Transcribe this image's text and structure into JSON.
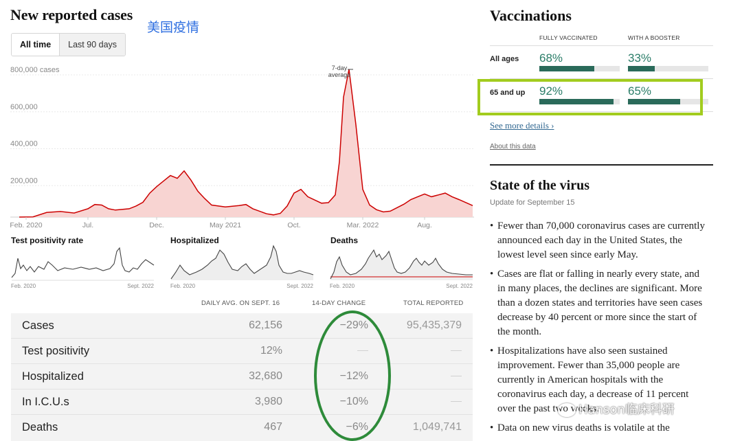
{
  "cases_panel": {
    "title": "New reported cases",
    "annotation": "美国疫情",
    "toggle": {
      "active": "All time",
      "inactive": "Last 90 days"
    }
  },
  "chart_data": {
    "type": "area",
    "title": "",
    "ylabel": "cases",
    "y_ticks": [
      "800,000 cases",
      "600,000",
      "400,000",
      "200,000"
    ],
    "ylim": [
      0,
      850000
    ],
    "x_ticks": [
      "Feb. 2020",
      "Jul.",
      "Dec.",
      "May 2021",
      "Oct.",
      "Mar. 2022",
      "Aug."
    ],
    "peak_annotation": [
      "7-day",
      "average"
    ],
    "series": [
      {
        "name": "",
        "x_month_index": [
          0,
          1,
          2,
          3,
          4,
          5,
          5.5,
          6,
          6.5,
          7,
          8,
          8.5,
          9,
          9.5,
          10,
          10.5,
          11,
          11.5,
          12,
          12.5,
          13,
          13.5,
          14,
          15,
          16,
          16.5,
          17,
          18,
          18.5,
          19,
          19.5,
          20,
          20.5,
          21,
          22,
          22.5,
          23,
          23.3,
          23.6,
          24,
          24.5,
          25,
          25.5,
          26,
          26.5,
          27,
          28,
          28.5,
          29,
          29.5,
          30,
          30.5,
          31,
          31.5,
          32,
          33
        ],
        "values": [
          0,
          1000,
          25000,
          30000,
          22000,
          45000,
          68000,
          65000,
          45000,
          38000,
          45000,
          60000,
          80000,
          130000,
          165000,
          195000,
          225000,
          210000,
          250000,
          200000,
          140000,
          100000,
          65000,
          55000,
          62000,
          68000,
          45000,
          18000,
          12000,
          20000,
          60000,
          130000,
          150000,
          110000,
          75000,
          78000,
          120000,
          300000,
          650000,
          800000,
          500000,
          150000,
          65000,
          40000,
          28000,
          32000,
          70000,
          95000,
          110000,
          125000,
          110000,
          120000,
          130000,
          110000,
          95000,
          62000
        ]
      }
    ]
  },
  "mini_charts": [
    {
      "title": "Test positivity rate",
      "start": "Feb. 2020",
      "end": "Sept. 2022"
    },
    {
      "title": "Hospitalized",
      "start": "Feb. 2020",
      "end": "Sept. 2022"
    },
    {
      "title": "Deaths",
      "start": "Feb. 2020",
      "end": "Sept. 2022"
    }
  ],
  "table": {
    "headers": [
      "DAILY AVG. ON SEPT. 16",
      "14-DAY CHANGE",
      "TOTAL REPORTED"
    ],
    "rows": [
      {
        "label": "Cases",
        "daily": "62,156",
        "change": "−29%",
        "total": "95,435,379"
      },
      {
        "label": "Test positivity",
        "daily": "12%",
        "change": "",
        "total": ""
      },
      {
        "label": "Hospitalized",
        "daily": "32,680",
        "change": "−12%",
        "total": ""
      },
      {
        "label": "In I.C.U.s",
        "daily": "3,980",
        "change": "−10%",
        "total": ""
      },
      {
        "label": "Deaths",
        "daily": "467",
        "change": "−6%",
        "total": "1,049,741"
      }
    ]
  },
  "vaccinations": {
    "title": "Vaccinations",
    "col1": "FULLY VACCINATED",
    "col2": "WITH A BOOSTER",
    "rows": [
      {
        "label": "All ages",
        "fully": "68%",
        "fully_value": 0.68,
        "booster": "33%",
        "booster_value": 0.33
      },
      {
        "label": "65 and up",
        "fully": "92%",
        "fully_value": 0.92,
        "booster": "65%",
        "booster_value": 0.65
      }
    ],
    "see_more": "See more details ›",
    "about": "About this data",
    "colors": {
      "bar": "#2a6a5a",
      "pct_text": "#2a7d68",
      "highlight": "#a2cc1e"
    }
  },
  "state_of_virus": {
    "title": "State of the virus",
    "update": "Update for September 15",
    "bullets": [
      "Fewer than 70,000 coronavirus cases are currently announced each day in the United States, the lowest level seen since early May.",
      "Cases are flat or falling in nearly every state, and in many places, the declines are significant. More than a dozen states and territories have seen cases decrease by 40 percent or more since the start of the month.",
      "Hospitalizations have also seen sustained improvement. Fewer than 35,000 people are currently in American hospitals with the coronavirus each day, a decrease of 11 percent over the past two weeks.",
      "Data on new virus deaths is volatile at the"
    ]
  },
  "watermark": "Hanson临床科研"
}
